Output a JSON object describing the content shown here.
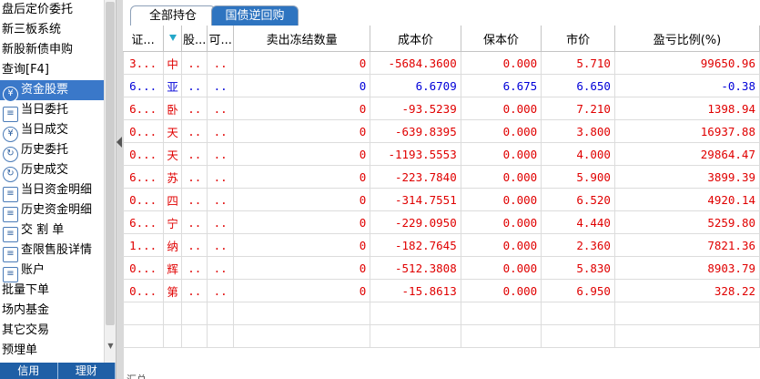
{
  "sidebar": {
    "items": [
      {
        "label": "盘后定价委托",
        "icon": "",
        "selected": false
      },
      {
        "label": "新三板系统",
        "icon": "",
        "selected": false
      },
      {
        "label": "新股新债申购",
        "icon": "",
        "selected": false
      },
      {
        "label": "查询[F4]",
        "icon": "",
        "selected": false
      },
      {
        "label": "资金股票",
        "icon": "¥",
        "selected": true
      },
      {
        "label": "当日委托",
        "icon": "≡",
        "selected": false
      },
      {
        "label": "当日成交",
        "icon": "¥",
        "selected": false
      },
      {
        "label": "历史委托",
        "icon": "↻",
        "selected": false
      },
      {
        "label": "历史成交",
        "icon": "↻",
        "selected": false
      },
      {
        "label": "当日资金明细",
        "icon": "≡",
        "selected": false
      },
      {
        "label": "历史资金明细",
        "icon": "≡",
        "selected": false
      },
      {
        "label": "交 割 单",
        "icon": "≡",
        "selected": false
      },
      {
        "label": "查限售股详情",
        "icon": "≡",
        "selected": false
      },
      {
        "label": "账户",
        "icon": "≡",
        "selected": false
      },
      {
        "label": "批量下单",
        "icon": "",
        "selected": false
      },
      {
        "label": "场内基金",
        "icon": "",
        "selected": false
      },
      {
        "label": "其它交易",
        "icon": "",
        "selected": false
      },
      {
        "label": "预埋单",
        "icon": "",
        "selected": false
      }
    ],
    "bottom_tabs": [
      "信用",
      "理财"
    ]
  },
  "tabs": [
    "全部持仓",
    "国债逆回购"
  ],
  "table": {
    "headers": [
      "证...",
      "",
      "股...",
      "可...",
      "卖出冻结数量",
      "成本价",
      "保本价",
      "市价",
      "盈亏比例(%)"
    ],
    "rows": [
      {
        "code": "3...",
        "name": "中",
        "c3": "..",
        "c4": "..",
        "frozen": "0",
        "cost": "-5684.3600",
        "breakeven": "0.000",
        "price": "5.710",
        "pnl": "99650.96",
        "color": "red"
      },
      {
        "code": "6...",
        "name": "亚",
        "c3": "..",
        "c4": "..",
        "frozen": "0",
        "cost": "6.6709",
        "breakeven": "6.675",
        "price": "6.650",
        "pnl": "-0.38",
        "color": "blue"
      },
      {
        "code": "6...",
        "name": "卧",
        "c3": "..",
        "c4": "..",
        "frozen": "0",
        "cost": "-93.5239",
        "breakeven": "0.000",
        "price": "7.210",
        "pnl": "1398.94",
        "color": "red"
      },
      {
        "code": "0...",
        "name": "天",
        "c3": "..",
        "c4": "..",
        "frozen": "0",
        "cost": "-639.8395",
        "breakeven": "0.000",
        "price": "3.800",
        "pnl": "16937.88",
        "color": "red"
      },
      {
        "code": "0...",
        "name": "天",
        "c3": "..",
        "c4": "..",
        "frozen": "0",
        "cost": "-1193.5553",
        "breakeven": "0.000",
        "price": "4.000",
        "pnl": "29864.47",
        "color": "red"
      },
      {
        "code": "6...",
        "name": "苏",
        "c3": "..",
        "c4": "..",
        "frozen": "0",
        "cost": "-223.7840",
        "breakeven": "0.000",
        "price": "5.900",
        "pnl": "3899.39",
        "color": "red"
      },
      {
        "code": "0...",
        "name": "四",
        "c3": "..",
        "c4": "..",
        "frozen": "0",
        "cost": "-314.7551",
        "breakeven": "0.000",
        "price": "6.520",
        "pnl": "4920.14",
        "color": "red"
      },
      {
        "code": "6...",
        "name": "宁",
        "c3": "..",
        "c4": "..",
        "frozen": "0",
        "cost": "-229.0950",
        "breakeven": "0.000",
        "price": "4.440",
        "pnl": "5259.80",
        "color": "red"
      },
      {
        "code": "1...",
        "name": "纳",
        "c3": "..",
        "c4": "..",
        "frozen": "0",
        "cost": "-182.7645",
        "breakeven": "0.000",
        "price": "2.360",
        "pnl": "7821.36",
        "color": "red"
      },
      {
        "code": "0...",
        "name": "辉",
        "c3": "..",
        "c4": "..",
        "frozen": "0",
        "cost": "-512.3808",
        "breakeven": "0.000",
        "price": "5.830",
        "pnl": "8903.79",
        "color": "red"
      },
      {
        "code": "0...",
        "name": "第",
        "c3": "..",
        "c4": "..",
        "frozen": "0",
        "cost": "-15.8613",
        "breakeven": "0.000",
        "price": "6.950",
        "pnl": "328.22",
        "color": "red"
      }
    ],
    "footer": "汇总"
  },
  "colors": {
    "selected": "#3a78c9",
    "tab_active": "#2e74c0",
    "gain": "#e00000",
    "loss": "#0000d8"
  }
}
